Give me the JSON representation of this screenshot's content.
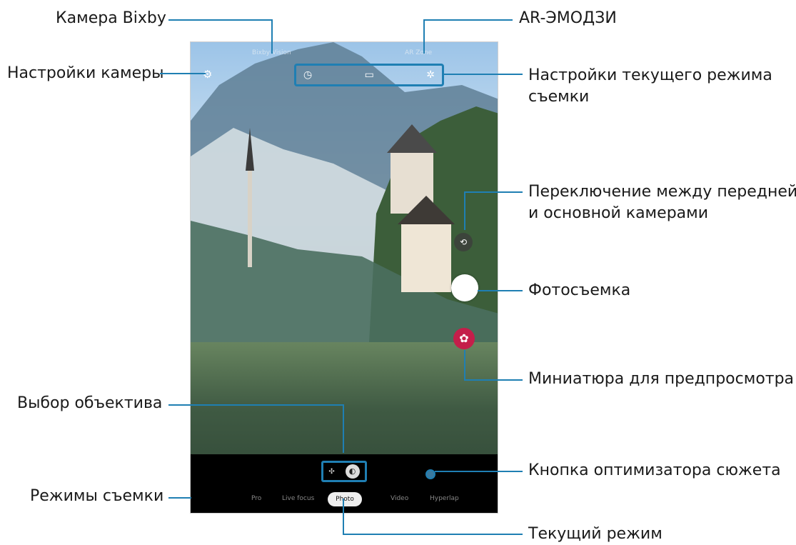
{
  "labels": {
    "bixby": "Камера Bixby",
    "camera_settings": "Настройки камеры",
    "ar_emoji": "AR-ЭМОДЗИ",
    "mode_settings_line1": "Настройки текущего режима",
    "mode_settings_line2": "съемки",
    "switch_line1": "Переключение между передней",
    "switch_line2": "и основной камерами",
    "shoot": "Фотосъемка",
    "thumbnail": "Миниатюра для предпросмотра",
    "lens": "Выбор объектива",
    "optimizer": "Кнопка оптимизатора сюжета",
    "modes": "Режимы съемки",
    "current_mode": "Текущий режим"
  },
  "screen": {
    "status_left": "Bixby Vision",
    "status_right": "AR Zone",
    "modes": [
      "Pro",
      "Live focus",
      "Video",
      "Hyperlap"
    ],
    "current_mode": "Photo"
  },
  "icons": {
    "gear": "gear-icon",
    "top": [
      "timer-icon",
      "ratio-icon",
      "effects-icon"
    ],
    "switch": "camera-switch-icon",
    "thumb": "gallery-thumbnail-icon"
  },
  "colors": {
    "accent": "#1f7fb3",
    "thumb": "#c41e4a"
  }
}
